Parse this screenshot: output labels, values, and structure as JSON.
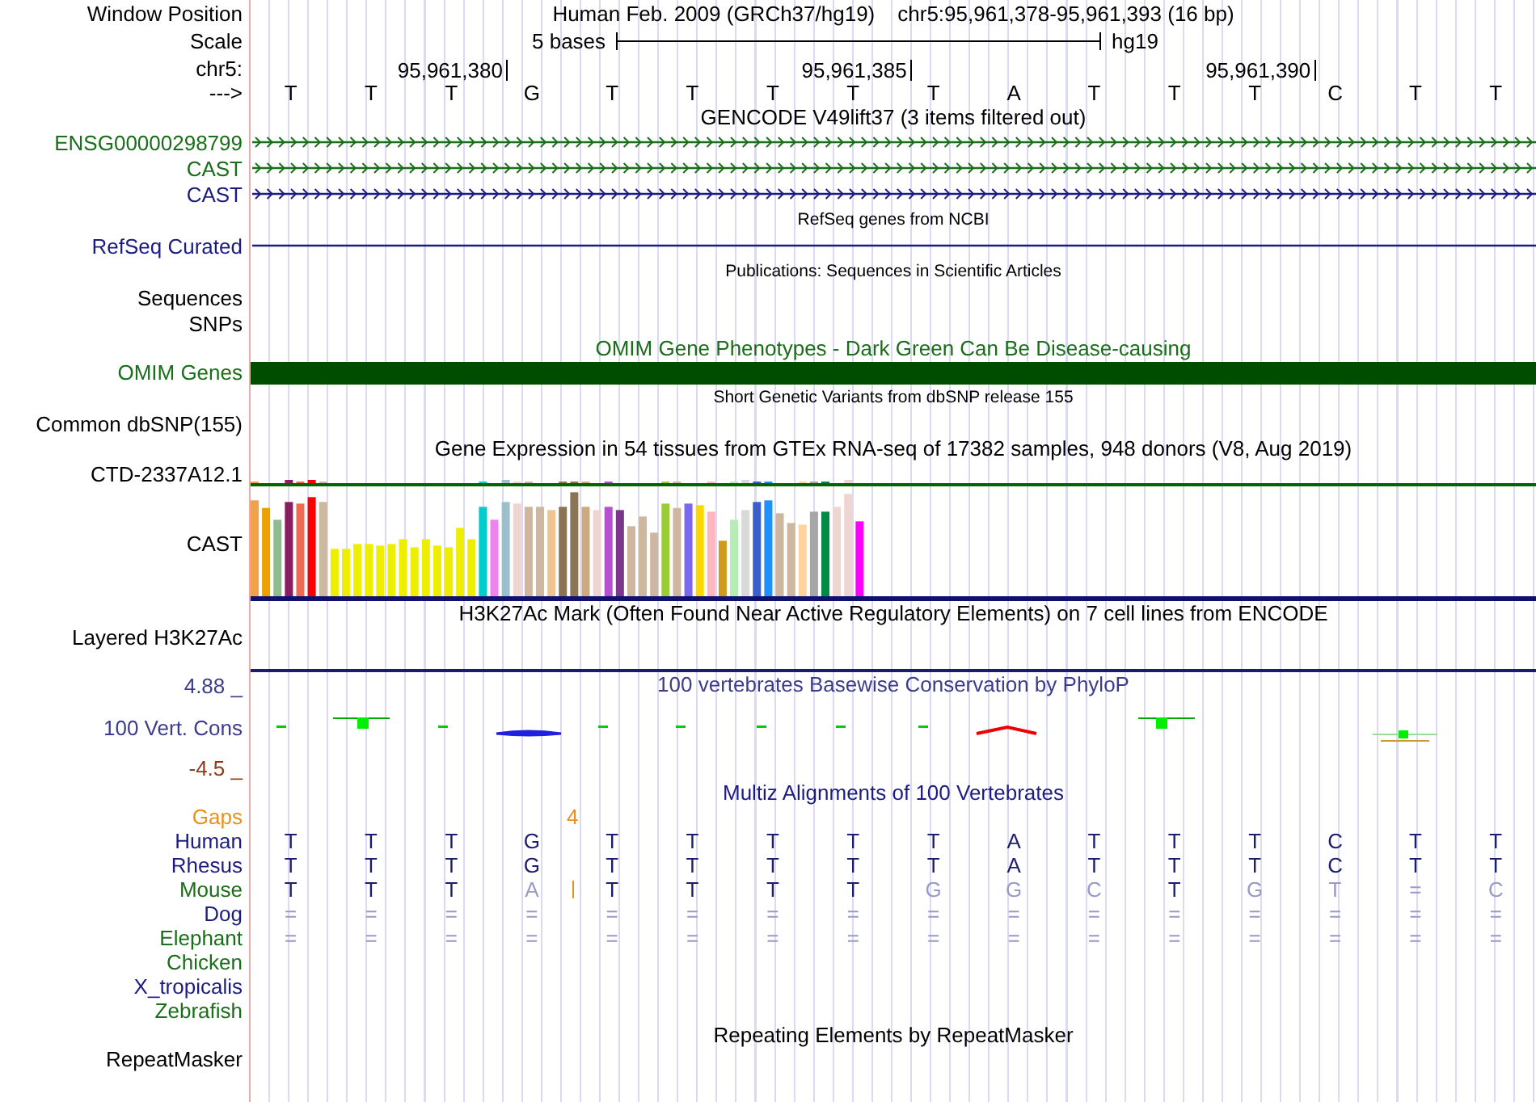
{
  "header": {
    "position_label": "Window Position",
    "assembly": "Human Feb. 2009 (GRCh37/hg19)",
    "position": "chr5:95,961,378-95,961,393 (16 bp)",
    "scale_label": "Scale",
    "scale_text": "5 bases",
    "scale_db": "hg19",
    "chrom_label": "chr5:",
    "ticks": [
      "95,961,380",
      "95,961,385",
      "95,961,390"
    ],
    "strand_label": "--->",
    "bases": [
      "T",
      "T",
      "T",
      "G",
      "T",
      "T",
      "T",
      "T",
      "T",
      "A",
      "T",
      "T",
      "T",
      "C",
      "T",
      "T"
    ]
  },
  "tracks": [
    {
      "kind": "title",
      "text": "GENCODE V49lift37 (3 items filtered out)",
      "color": "#000000"
    },
    {
      "kind": "gene",
      "label": "ENSG00000298799",
      "color": "#1a6e1a",
      "chevrons": true
    },
    {
      "kind": "gene",
      "label": "CAST",
      "color": "#1a6e1a",
      "chevrons": true
    },
    {
      "kind": "gene",
      "label": "CAST",
      "color": "#1c1c80",
      "chevrons": true
    },
    {
      "kind": "small_title",
      "text": "RefSeq genes from NCBI",
      "color": "#000000"
    },
    {
      "kind": "gene",
      "label": "RefSeq Curated",
      "color": "#1c1c80",
      "chevrons": false
    },
    {
      "kind": "small_title",
      "text": "Publications: Sequences in Scientific Articles",
      "color": "#000000"
    },
    {
      "kind": "label",
      "label": "Sequences",
      "color": "#000000"
    },
    {
      "kind": "label",
      "label": "SNPs",
      "color": "#000000"
    },
    {
      "kind": "title",
      "text": "OMIM Gene Phenotypes - Dark Green Can Be Disease-causing",
      "color": "#1a6e1a"
    },
    {
      "kind": "bar",
      "label": "OMIM Genes",
      "color": "#1a6e1a"
    },
    {
      "kind": "small_title",
      "text": "Short Genetic Variants from dbSNP release 155",
      "color": "#000000"
    },
    {
      "kind": "label",
      "label": "Common dbSNP(155)",
      "color": "#000000"
    },
    {
      "kind": "title",
      "text": "Gene Expression in 54 tissues from GTEx RNA-seq of 17382 samples, 948 donors (V8, Aug 2019)",
      "color": "#000000"
    },
    {
      "kind": "gtex_small",
      "label": "CTD-2337A12.1",
      "color": "#000000"
    },
    {
      "kind": "gtex",
      "label": "CAST",
      "color": "#000000"
    },
    {
      "kind": "title",
      "text": "H3K27Ac Mark (Often Found Near Active Regulatory Elements) on 7 cell lines from ENCODE",
      "color": "#000000"
    },
    {
      "kind": "layered",
      "label": "Layered H3K27Ac",
      "color": "#000000"
    },
    {
      "kind": "wiggle",
      "title": "100 vertebrates Basewise Conservation by PhyloP",
      "max_label": "4.88 _",
      "label": "100 Vert. Cons",
      "min_label": "-4.5 _",
      "color": "#3c3c8c"
    },
    {
      "kind": "title",
      "text": "Multiz Alignments of 100 Vertebrates",
      "color": "#1c1c80"
    },
    {
      "kind": "gaps",
      "label": "Gaps",
      "color": "#e8901c",
      "count": "4"
    },
    {
      "kind": "species",
      "label": "Human",
      "color": "#1c1c80",
      "bases": [
        {
          "base": "T",
          "mismatch": false
        },
        {
          "base": "T",
          "mismatch": false
        },
        {
          "base": "T",
          "mismatch": false
        },
        {
          "base": "G",
          "mismatch": false
        },
        {
          "base": "T",
          "mismatch": false
        },
        {
          "base": "T",
          "mismatch": false
        },
        {
          "base": "T",
          "mismatch": false
        },
        {
          "base": "T",
          "mismatch": false
        },
        {
          "base": "T",
          "mismatch": false
        },
        {
          "base": "A",
          "mismatch": false
        },
        {
          "base": "T",
          "mismatch": false
        },
        {
          "base": "T",
          "mismatch": false
        },
        {
          "base": "T",
          "mismatch": false
        },
        {
          "base": "C",
          "mismatch": false
        },
        {
          "base": "T",
          "mismatch": false
        },
        {
          "base": "T",
          "mismatch": false
        }
      ]
    },
    {
      "kind": "species",
      "label": "Rhesus",
      "color": "#1c1c80",
      "bases": [
        {
          "base": "T",
          "mismatch": false
        },
        {
          "base": "T",
          "mismatch": false
        },
        {
          "base": "T",
          "mismatch": false
        },
        {
          "base": "G",
          "mismatch": false
        },
        {
          "base": "T",
          "mismatch": false
        },
        {
          "base": "T",
          "mismatch": false
        },
        {
          "base": "T",
          "mismatch": false
        },
        {
          "base": "T",
          "mismatch": false
        },
        {
          "base": "T",
          "mismatch": false
        },
        {
          "base": "A",
          "mismatch": false
        },
        {
          "base": "T",
          "mismatch": false
        },
        {
          "base": "T",
          "mismatch": false
        },
        {
          "base": "T",
          "mismatch": false
        },
        {
          "base": "C",
          "mismatch": false
        },
        {
          "base": "T",
          "mismatch": false
        },
        {
          "base": "T",
          "mismatch": false
        }
      ]
    },
    {
      "kind": "species",
      "label": "Mouse",
      "color": "#1a6e1a",
      "bases": [
        {
          "base": "T",
          "mismatch": false
        },
        {
          "base": "T",
          "mismatch": false
        },
        {
          "base": "T",
          "mismatch": false
        },
        {
          "base": "A",
          "mismatch": true,
          "insertion": true
        },
        {
          "base": "T",
          "mismatch": false
        },
        {
          "base": "T",
          "mismatch": false
        },
        {
          "base": "T",
          "mismatch": false
        },
        {
          "base": "T",
          "mismatch": false
        },
        {
          "base": "G",
          "mismatch": true
        },
        {
          "base": "G",
          "mismatch": true
        },
        {
          "base": "C",
          "mismatch": true
        },
        {
          "base": "T",
          "mismatch": false
        },
        {
          "base": "G",
          "mismatch": true
        },
        {
          "base": "T",
          "mismatch": true
        },
        {
          "base": "=",
          "mismatch": true
        },
        {
          "base": "C",
          "mismatch": true
        }
      ]
    },
    {
      "kind": "species",
      "label": "Dog",
      "color": "#1c1c80",
      "bases": [
        {
          "base": "=",
          "mismatch": true
        },
        {
          "base": "=",
          "mismatch": true
        },
        {
          "base": "=",
          "mismatch": true
        },
        {
          "base": "=",
          "mismatch": true
        },
        {
          "base": "=",
          "mismatch": true
        },
        {
          "base": "=",
          "mismatch": true
        },
        {
          "base": "=",
          "mismatch": true
        },
        {
          "base": "=",
          "mismatch": true
        },
        {
          "base": "=",
          "mismatch": true
        },
        {
          "base": "=",
          "mismatch": true
        },
        {
          "base": "=",
          "mismatch": true
        },
        {
          "base": "=",
          "mismatch": true
        },
        {
          "base": "=",
          "mismatch": true
        },
        {
          "base": "=",
          "mismatch": true
        },
        {
          "base": "=",
          "mismatch": true
        },
        {
          "base": "=",
          "mismatch": true
        }
      ]
    },
    {
      "kind": "species",
      "label": "Elephant",
      "color": "#1a6e1a",
      "bases": [
        {
          "base": "=",
          "mismatch": true
        },
        {
          "base": "=",
          "mismatch": true
        },
        {
          "base": "=",
          "mismatch": true
        },
        {
          "base": "=",
          "mismatch": true
        },
        {
          "base": "=",
          "mismatch": true
        },
        {
          "base": "=",
          "mismatch": true
        },
        {
          "base": "=",
          "mismatch": true
        },
        {
          "base": "=",
          "mismatch": true
        },
        {
          "base": "=",
          "mismatch": true
        },
        {
          "base": "=",
          "mismatch": true
        },
        {
          "base": "=",
          "mismatch": true
        },
        {
          "base": "=",
          "mismatch": true
        },
        {
          "base": "=",
          "mismatch": true
        },
        {
          "base": "=",
          "mismatch": true
        },
        {
          "base": "=",
          "mismatch": true
        },
        {
          "base": "=",
          "mismatch": true
        }
      ]
    },
    {
      "kind": "species",
      "label": "Chicken",
      "color": "#1a6e1a"
    },
    {
      "kind": "species",
      "label": "X_tropicalis",
      "color": "#1c1c80"
    },
    {
      "kind": "species",
      "label": "Zebrafish",
      "color": "#1a6e1a"
    },
    {
      "kind": "title",
      "text": "Repeating Elements by RepeatMasker",
      "color": "#000000"
    },
    {
      "kind": "label",
      "label": "RepeatMasker",
      "color": "#000000"
    }
  ]
}
